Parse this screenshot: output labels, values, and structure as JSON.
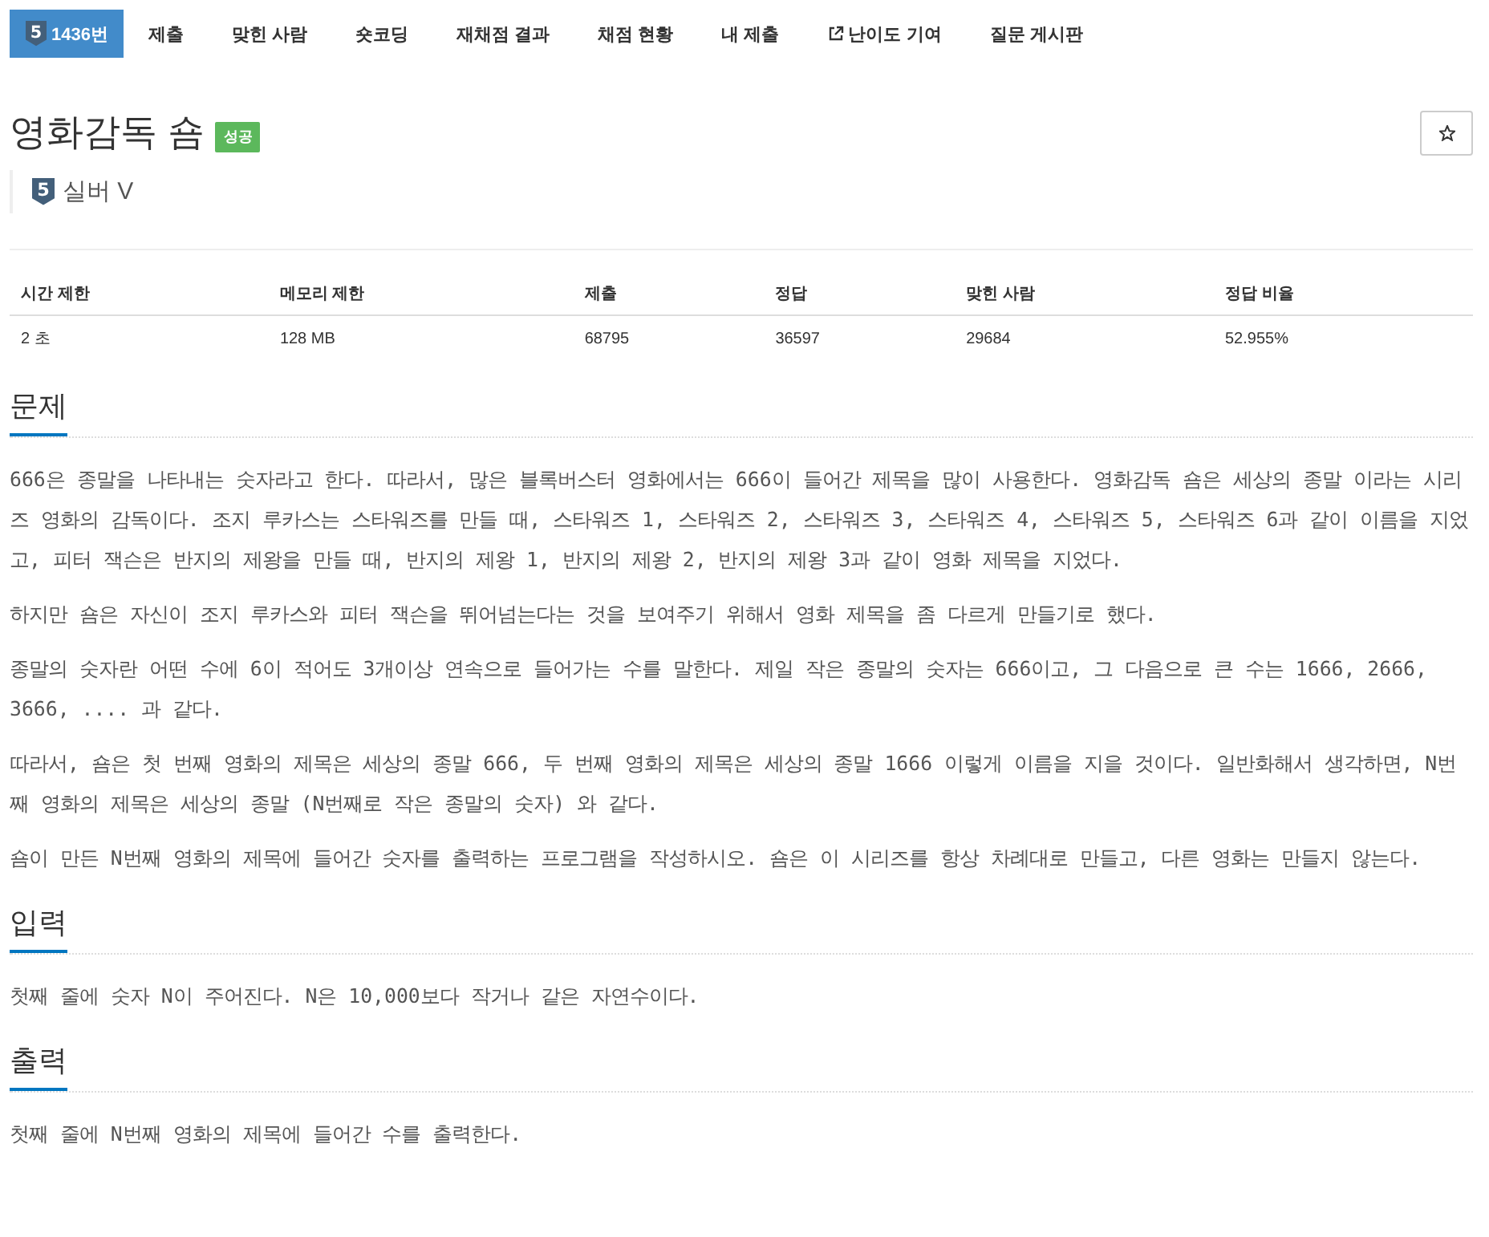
{
  "tabs": [
    {
      "kind": "problem",
      "tier": "5",
      "label": "1436번",
      "selected": true
    },
    {
      "kind": "plain",
      "label": "제출",
      "selected": false
    },
    {
      "kind": "plain",
      "label": "맞힌 사람",
      "selected": false
    },
    {
      "kind": "plain",
      "label": "숏코딩",
      "selected": false
    },
    {
      "kind": "plain",
      "label": "재채점 결과",
      "selected": false
    },
    {
      "kind": "plain",
      "label": "채점 현황",
      "selected": false
    },
    {
      "kind": "plain",
      "label": "내 제출",
      "selected": false
    },
    {
      "kind": "external",
      "label": "난이도 기여",
      "selected": false
    },
    {
      "kind": "plain",
      "label": "질문 게시판",
      "selected": false
    }
  ],
  "problem": {
    "title": "영화감독 숌",
    "badge": "성공",
    "tier_number": "5",
    "tier": "실버 V"
  },
  "table": {
    "columns": [
      "시간 제한",
      "메모리 제한",
      "제출",
      "정답",
      "맞힌 사람",
      "정답 비율"
    ],
    "rows": [
      [
        "2 초",
        "128 MB",
        "68795",
        "36597",
        "29684",
        "52.955%"
      ]
    ]
  },
  "sections": [
    {
      "heading": "문제",
      "paragraphs": [
        "666은 종말을 나타내는 숫자라고 한다. 따라서, 많은 블록버스터 영화에서는 666이 들어간 제목을 많이 사용한다. 영화감독 숌은 세상의 종말 이라는 시리즈 영화의 감독이다. 조지 루카스는 스타워즈를 만들 때, 스타워즈 1, 스타워즈 2, 스타워즈 3, 스타워즈 4, 스타워즈 5, 스타워즈 6과 같이 이름을 지었고, 피터 잭슨은 반지의 제왕을 만들 때, 반지의 제왕 1, 반지의 제왕 2, 반지의 제왕 3과 같이 영화 제목을 지었다.",
        "하지만 숌은 자신이 조지 루카스와 피터 잭슨을 뛰어넘는다는 것을 보여주기 위해서 영화 제목을 좀 다르게 만들기로 했다.",
        "종말의 숫자란 어떤 수에 6이 적어도 3개이상 연속으로 들어가는 수를 말한다. 제일 작은 종말의 숫자는 666이고, 그 다음으로 큰 수는 1666, 2666, 3666, .... 과 같다.",
        "따라서, 숌은 첫 번째 영화의 제목은 세상의 종말 666, 두 번째 영화의 제목은 세상의 종말 1666 이렇게 이름을 지을 것이다. 일반화해서 생각하면, N번째 영화의 제목은 세상의 종말 (N번째로 작은 종말의 숫자) 와 같다.",
        "숌이 만든 N번째 영화의 제목에 들어간 숫자를 출력하는 프로그램을 작성하시오. 숌은 이 시리즈를 항상 차례대로 만들고, 다른 영화는 만들지 않는다."
      ]
    },
    {
      "heading": "입력",
      "paragraphs": [
        "첫째 줄에 숫자 N이 주어진다. N은 10,000보다 작거나 같은 자연수이다."
      ]
    },
    {
      "heading": "출력",
      "paragraphs": [
        "첫째 줄에 N번째 영화의 제목에 들어간 수를 출력한다."
      ]
    }
  ]
}
